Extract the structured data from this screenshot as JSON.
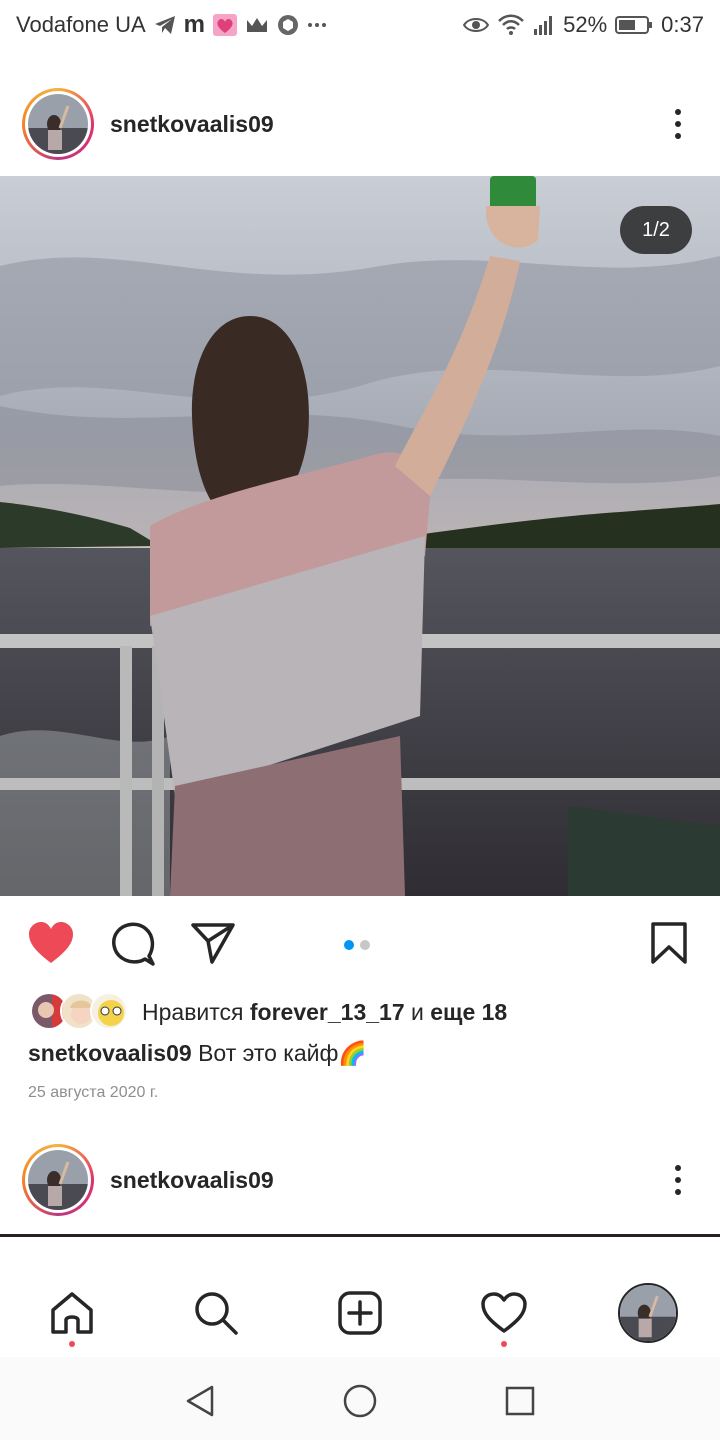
{
  "status_bar": {
    "carrier": "Vodafone UA",
    "app_letter": "m",
    "battery": "52%",
    "time": "0:37"
  },
  "post": {
    "username": "snetkovaalis09",
    "photo_counter": "1/2",
    "likes_prefix": "Нравится",
    "liked_by": "forever_13_17",
    "likes_connector": "и",
    "likes_more": "еще 18",
    "caption_user": "snetkovaalis09",
    "caption_text": "Вот это кайф🌈",
    "date": "25 августа 2020 г.",
    "liked": true,
    "carousel_index": 1,
    "carousel_total": 2
  },
  "next_post": {
    "username": "snetkovaalis09"
  },
  "colors": {
    "like_red": "#ed4956",
    "accent_blue": "#0095f6",
    "text": "#262626",
    "secondary_text": "#8e8e8e"
  },
  "icons": {
    "actions": [
      "heart-icon",
      "comment-icon",
      "share-icon",
      "bookmark-icon"
    ],
    "nav": [
      "home-icon",
      "search-icon",
      "add-post-icon",
      "activity-icon",
      "profile-avatar"
    ],
    "system": [
      "back-icon",
      "home-circle-icon",
      "recents-icon"
    ]
  }
}
